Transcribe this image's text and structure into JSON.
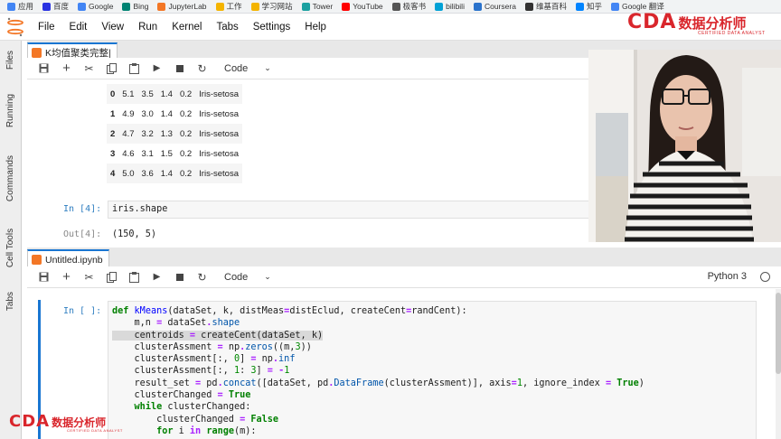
{
  "bookmarks": [
    {
      "label": "应用",
      "icon": "apps-grid-icon",
      "color": "#4285f4"
    },
    {
      "label": "百度",
      "icon": "baidu-icon",
      "color": "#2932e1"
    },
    {
      "label": "Google",
      "icon": "google-icon",
      "color": "#4285f4"
    },
    {
      "label": "Bing",
      "icon": "bing-icon",
      "color": "#008373"
    },
    {
      "label": "JupyterLab",
      "icon": "jupyter-icon",
      "color": "#f37726"
    },
    {
      "label": "工作",
      "icon": "folder-icon",
      "color": "#f4b400"
    },
    {
      "label": "学习网站",
      "icon": "folder-icon",
      "color": "#f4b400"
    },
    {
      "label": "Tower",
      "icon": "tower-icon",
      "color": "#1aa0a0"
    },
    {
      "label": "YouTube",
      "icon": "youtube-icon",
      "color": "#ff0000"
    },
    {
      "label": "极客书",
      "icon": "doc-icon",
      "color": "#555555"
    },
    {
      "label": "bilibili",
      "icon": "bilibili-icon",
      "color": "#00a1d6"
    },
    {
      "label": "Coursera",
      "icon": "globe-icon",
      "color": "#2a73cc"
    },
    {
      "label": "维基百科",
      "icon": "wikipedia-icon",
      "color": "#333333"
    },
    {
      "label": "知乎",
      "icon": "zhihu-icon",
      "color": "#0084ff"
    },
    {
      "label": "Google 翻译",
      "icon": "translate-icon",
      "color": "#4285f4"
    }
  ],
  "menu": [
    "File",
    "Edit",
    "View",
    "Run",
    "Kernel",
    "Tabs",
    "Settings",
    "Help"
  ],
  "sidebar_tabs": [
    "Files",
    "Running",
    "Commands",
    "Cell Tools",
    "Tabs"
  ],
  "top_panel": {
    "tab_title": "K均值聚类完整|",
    "cell_type": "Code",
    "dataframe_rows": [
      {
        "index": "0",
        "c1": "5.1",
        "c2": "3.5",
        "c3": "1.4",
        "c4": "0.2",
        "species": "Iris-setosa"
      },
      {
        "index": "1",
        "c1": "4.9",
        "c2": "3.0",
        "c3": "1.4",
        "c4": "0.2",
        "species": "Iris-setosa"
      },
      {
        "index": "2",
        "c1": "4.7",
        "c2": "3.2",
        "c3": "1.3",
        "c4": "0.2",
        "species": "Iris-setosa"
      },
      {
        "index": "3",
        "c1": "4.6",
        "c2": "3.1",
        "c3": "1.5",
        "c4": "0.2",
        "species": "Iris-setosa"
      },
      {
        "index": "4",
        "c1": "5.0",
        "c2": "3.6",
        "c3": "1.4",
        "c4": "0.2",
        "species": "Iris-setosa"
      }
    ],
    "in_prompt": "In [4]:",
    "in_code": "iris.shape",
    "out_prompt": "Out[4]:",
    "out_text": "(150, 5)"
  },
  "bottom_panel": {
    "tab_title": "Untitled.ipynb",
    "cell_type": "Code",
    "kernel": "Python 3",
    "in_prompt": "In [ ]:"
  },
  "brand": {
    "letters": "CDA",
    "cn": "数据分析师",
    "sub": "CERTIFIED DATA ANALYST",
    "color": "#d9262c"
  },
  "colors": {
    "accent": "#1976d2",
    "keyword": "#008000",
    "function": "#0000ff"
  }
}
